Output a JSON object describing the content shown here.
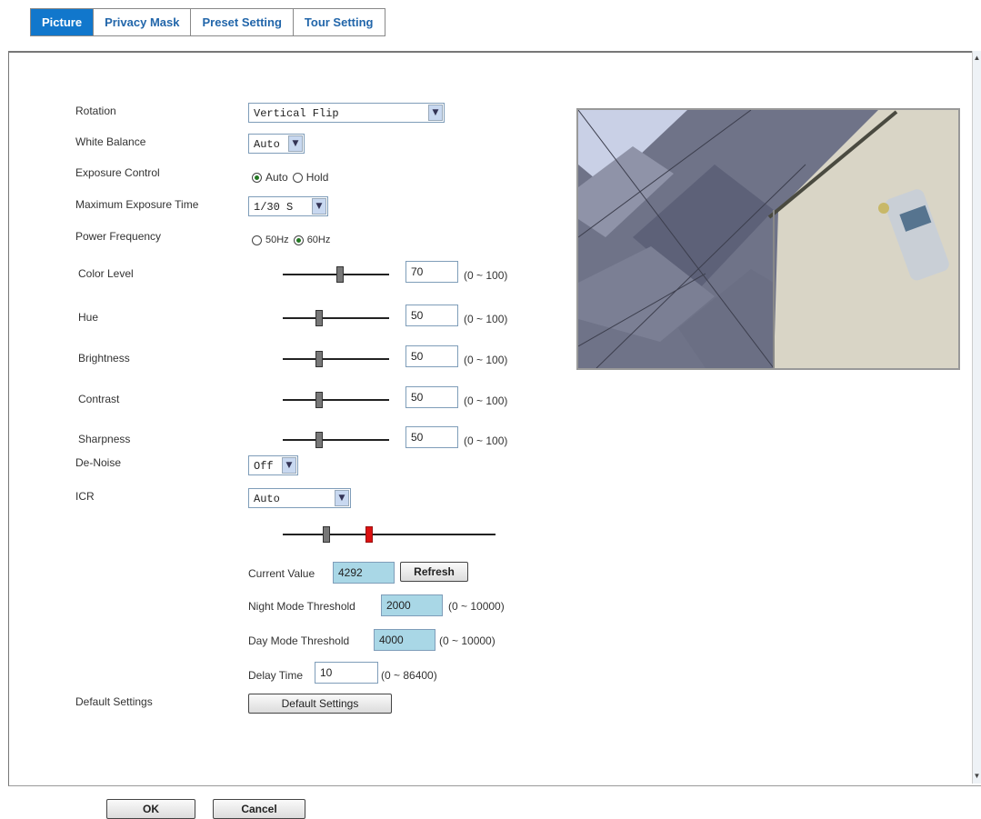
{
  "tabs": [
    "Picture",
    "Privacy Mask",
    "Preset Setting",
    "Tour Setting"
  ],
  "rotation": {
    "label": "Rotation",
    "value": "Vertical Flip"
  },
  "white_balance": {
    "label": "White Balance",
    "value": "Auto"
  },
  "exposure_control": {
    "label": "Exposure Control",
    "options": [
      "Auto",
      "Hold"
    ],
    "selected": "Auto"
  },
  "max_exposure": {
    "label": "Maximum Exposure Time",
    "value": "1/30 S"
  },
  "power_frequency": {
    "label": "Power Frequency",
    "options": [
      "50Hz",
      "60Hz"
    ],
    "selected": "60Hz"
  },
  "sliders": [
    {
      "label": "Color Level",
      "value": "70",
      "range": "(0 ~ 100)"
    },
    {
      "label": "Hue",
      "value": "50",
      "range": "(0 ~ 100)"
    },
    {
      "label": "Brightness",
      "value": "50",
      "range": "(0 ~ 100)"
    },
    {
      "label": "Contrast",
      "value": "50",
      "range": "(0 ~ 100)"
    },
    {
      "label": "Sharpness",
      "value": "50",
      "range": "(0 ~ 100)"
    }
  ],
  "de_noise": {
    "label": "De-Noise",
    "value": "Off"
  },
  "icr": {
    "label": "ICR",
    "value": "Auto",
    "current_value_label": "Current Value",
    "current_value": "4292",
    "refresh_label": "Refresh",
    "night_label": "Night Mode Threshold",
    "night_value": "2000",
    "night_range": "(0 ~ 10000)",
    "day_label": "Day Mode Threshold",
    "day_value": "4000",
    "day_range": "(0 ~ 10000)",
    "delay_label": "Delay Time",
    "delay_value": "10",
    "delay_range": "(0 ~ 86400)"
  },
  "default_settings": {
    "label": "Default Settings",
    "button": "Default Settings"
  },
  "footer": {
    "ok": "OK",
    "cancel": "Cancel"
  },
  "colors": {
    "tab_active_bg": "#1177cc",
    "tab_text": "#2266aa",
    "highlight_field": "#a9d7e6",
    "icr_marker": "#dd1111"
  }
}
